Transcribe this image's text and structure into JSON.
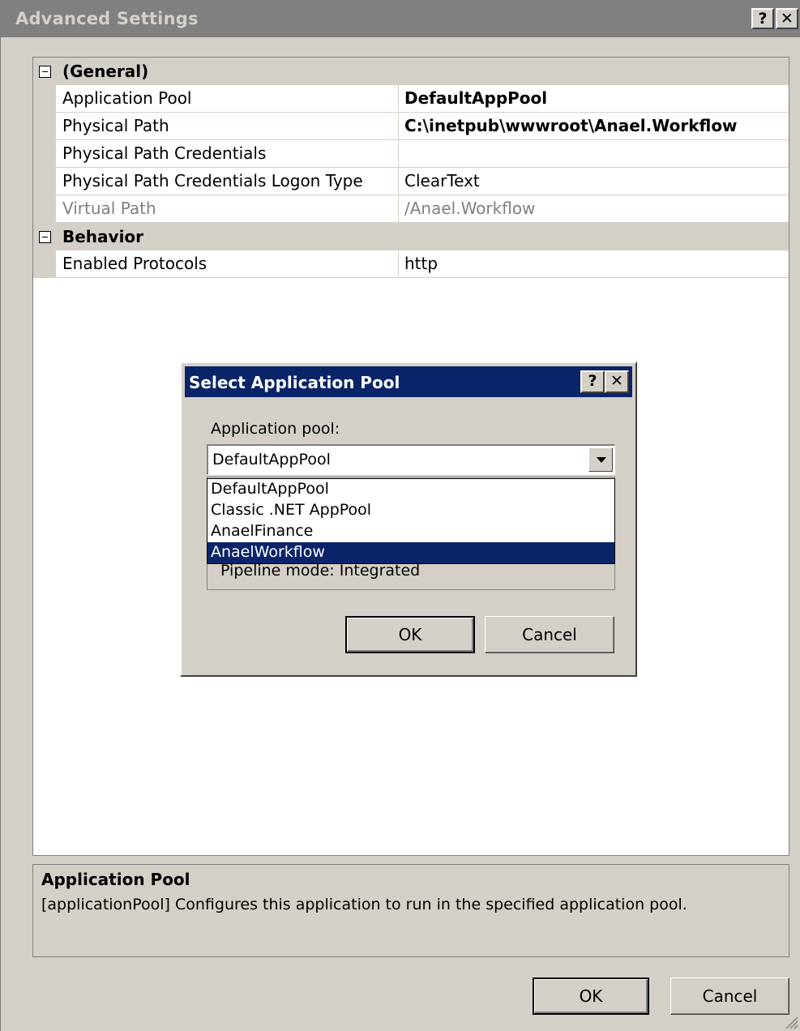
{
  "window": {
    "title": "Advanced Settings",
    "help_glyph": "?",
    "close_glyph": "✕"
  },
  "property_grid": {
    "categories": [
      {
        "label": "(General)",
        "properties": [
          {
            "name": "Application Pool",
            "value": "DefaultAppPool",
            "bold": true
          },
          {
            "name": "Physical Path",
            "value": "C:\\inetpub\\wwwroot\\Anael.Workflow",
            "bold": true
          },
          {
            "name": "Physical Path Credentials",
            "value": ""
          },
          {
            "name": "Physical Path Credentials Logon Type",
            "value": "ClearText"
          },
          {
            "name": "Virtual Path",
            "value": "/Anael.Workflow",
            "disabled": true
          }
        ]
      },
      {
        "label": "Behavior",
        "properties": [
          {
            "name": "Enabled Protocols",
            "value": "http"
          }
        ]
      }
    ]
  },
  "description": {
    "title": "Application Pool",
    "text": "[applicationPool] Configures this application to run in the specified application pool."
  },
  "buttons": {
    "ok": "OK",
    "cancel": "Cancel"
  },
  "dialog": {
    "title": "Select Application Pool",
    "help_glyph": "?",
    "close_glyph": "✕",
    "label": "Application pool:",
    "selected": "DefaultAppPool",
    "options": [
      "DefaultAppPool",
      "Classic .NET AppPool",
      "AnaelFinance",
      "AnaelWorkflow"
    ],
    "highlighted_option": "AnaelWorkflow",
    "pipeline_mode": "Pipeline mode: Integrated",
    "ok": "OK",
    "cancel": "Cancel"
  }
}
